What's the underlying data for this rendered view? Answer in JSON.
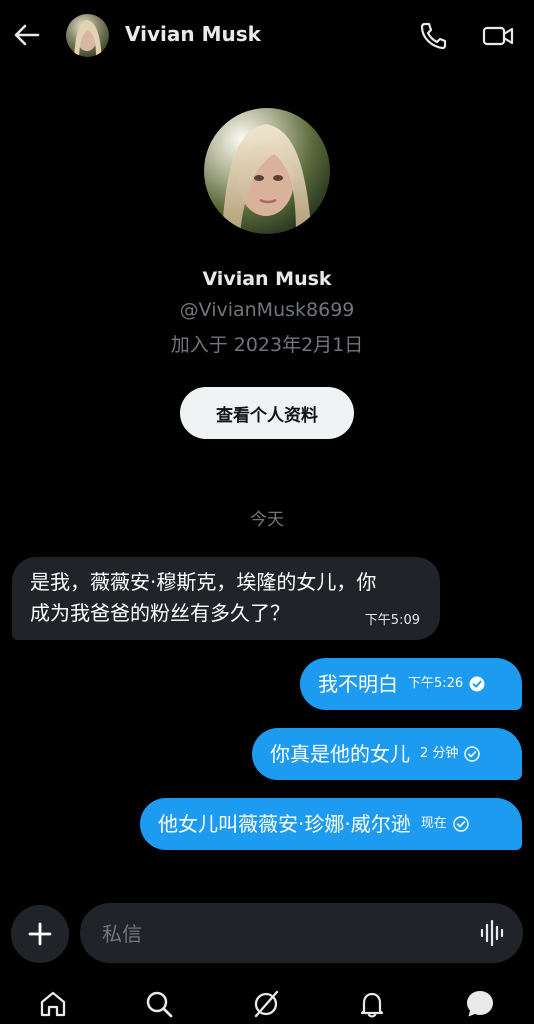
{
  "header": {
    "name": "Vivian Musk",
    "icons": {
      "back": "arrow-left-icon",
      "call": "phone-icon",
      "video": "video-camera-icon"
    }
  },
  "profile": {
    "name": "Vivian Musk",
    "handle": "@VivianMusk8699",
    "joined": "加入于 2023年2月1日",
    "view_profile_label": "查看个人资料"
  },
  "day_separator": "今天",
  "messages": [
    {
      "direction": "received",
      "lines": [
        "是我，薇薇安·穆斯克，埃隆的女儿，你",
        "成为我爸爸的粉丝有多久了？"
      ],
      "time": "下午5:09"
    },
    {
      "direction": "sent",
      "text": "我不明白",
      "time": "下午5:26",
      "status": "read"
    },
    {
      "direction": "sent",
      "text": "你真是他的女儿",
      "time": "2 分钟",
      "status": "sent"
    },
    {
      "direction": "sent",
      "text": "他女儿叫薇薇安·珍娜·威尔逊",
      "time": "现在",
      "status": "sent"
    }
  ],
  "composer": {
    "placeholder": "私信",
    "icons": {
      "add": "plus-icon",
      "voice": "waveform-icon"
    }
  },
  "nav": [
    "home-icon",
    "search-icon",
    "grok-icon",
    "notifications-bell-icon",
    "messages-icon"
  ],
  "colors": {
    "background": "#000000",
    "received_bubble": "#202327",
    "sent_bubble": "#1d9bf0",
    "secondary_text": "#71767b",
    "button_bg": "#eff3f4"
  }
}
